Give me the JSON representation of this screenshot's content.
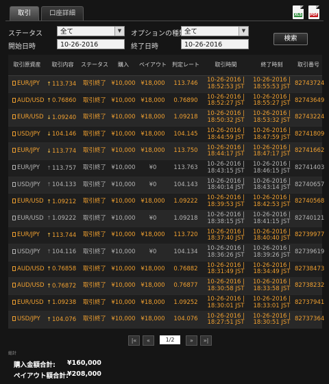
{
  "tabs": [
    {
      "label": "取引"
    },
    {
      "label": "口座詳細"
    }
  ],
  "icons": {
    "export_excel": "excel-file-icon",
    "export_pdf": "pdf-file-icon"
  },
  "filters": {
    "status_label": "ステータス",
    "status_value": "全て",
    "option_type_label": "オプションの種類",
    "option_type_value": "全て",
    "start_label": "開始日時",
    "start_value": "10-26-2016",
    "end_label": "終了日時",
    "end_value": "10-26-2016",
    "search_label": "検索"
  },
  "table": {
    "headers": [
      "取引原資産",
      "取引内容",
      "ステータス",
      "購入",
      "ペイアウト",
      "判定レート",
      "取引時間",
      "終了時刻",
      "取引番号"
    ],
    "rows": [
      {
        "asset": "EUR/JPY",
        "dir": "↑",
        "rate": "113.734",
        "status": "取引終了",
        "buy": "¥10,000",
        "payout": "¥18,000",
        "judge": "113.746",
        "open1": "10-26-2016 |",
        "open2": "18:52:53 JST",
        "close1": "10-26-2016 |",
        "close2": "18:55:53 JST",
        "id": "82743724",
        "result": "win"
      },
      {
        "asset": "AUD/USD",
        "dir": "↑",
        "rate": "0.76860",
        "status": "取引終了",
        "buy": "¥10,000",
        "payout": "¥18,000",
        "judge": "0.76890",
        "open1": "10-26-2016 |",
        "open2": "18:52:27 JST",
        "close1": "10-26-2016 |",
        "close2": "18:55:27 JST",
        "id": "82743649",
        "result": "win"
      },
      {
        "asset": "EUR/USD",
        "dir": "↓",
        "rate": "1.09240",
        "status": "取引終了",
        "buy": "¥10,000",
        "payout": "¥18,000",
        "judge": "1.09218",
        "open1": "10-26-2016 |",
        "open2": "18:50:32 JST",
        "close1": "10-26-2016 |",
        "close2": "18:53:32 JST",
        "id": "82743224",
        "result": "win"
      },
      {
        "asset": "USD/JPY",
        "dir": "↓",
        "rate": "104.146",
        "status": "取引終了",
        "buy": "¥10,000",
        "payout": "¥18,000",
        "judge": "104.145",
        "open1": "10-26-2016 |",
        "open2": "18:44:59 JST",
        "close1": "10-26-2016 |",
        "close2": "18:47:59 JST",
        "id": "82741809",
        "result": "win"
      },
      {
        "asset": "EUR/JPY",
        "dir": "↓",
        "rate": "113.774",
        "status": "取引終了",
        "buy": "¥10,000",
        "payout": "¥18,000",
        "judge": "113.750",
        "open1": "10-26-2016 |",
        "open2": "18:44:17 JST",
        "close1": "10-26-2016 |",
        "close2": "18:47:17 JST",
        "id": "82741662",
        "result": "win"
      },
      {
        "asset": "EUR/JPY",
        "dir": "↑",
        "rate": "113.757",
        "status": "取引終了",
        "buy": "¥10,000",
        "payout": "¥0",
        "judge": "113.763",
        "open1": "10-26-2016 |",
        "open2": "18:43:15 JST",
        "close1": "10-26-2016 |",
        "close2": "18:46:15 JST",
        "id": "82741403",
        "result": "loss"
      },
      {
        "asset": "USD/JPY",
        "dir": "↑",
        "rate": "104.133",
        "status": "取引終了",
        "buy": "¥10,000",
        "payout": "¥0",
        "judge": "104.143",
        "open1": "10-26-2016 |",
        "open2": "18:40:14 JST",
        "close1": "10-26-2016 |",
        "close2": "18:43:14 JST",
        "id": "82740657",
        "result": "loss"
      },
      {
        "asset": "EUR/USD",
        "dir": "↑",
        "rate": "1.09212",
        "status": "取引終了",
        "buy": "¥10,000",
        "payout": "¥18,000",
        "judge": "1.09222",
        "open1": "10-26-2016 |",
        "open2": "18:39:53 JST",
        "close1": "10-26-2016 |",
        "close2": "18:42:53 JST",
        "id": "82740568",
        "result": "win"
      },
      {
        "asset": "EUR/USD",
        "dir": "↑",
        "rate": "1.09222",
        "status": "取引終了",
        "buy": "¥10,000",
        "payout": "¥0",
        "judge": "1.09218",
        "open1": "10-26-2016 |",
        "open2": "18:38:15 JST",
        "close1": "10-26-2016 |",
        "close2": "18:41:15 JST",
        "id": "82740121",
        "result": "loss"
      },
      {
        "asset": "EUR/JPY",
        "dir": "↑",
        "rate": "113.744",
        "status": "取引終了",
        "buy": "¥10,000",
        "payout": "¥18,000",
        "judge": "113.720",
        "open1": "10-26-2016 |",
        "open2": "18:37:40 JST",
        "close1": "10-26-2016 |",
        "close2": "18:40:40 JST",
        "id": "82739977",
        "result": "win"
      },
      {
        "asset": "USD/JPY",
        "dir": "↑",
        "rate": "104.116",
        "status": "取引終了",
        "buy": "¥10,000",
        "payout": "¥0",
        "judge": "104.134",
        "open1": "10-26-2016 |",
        "open2": "18:36:26 JST",
        "close1": "10-26-2016 |",
        "close2": "18:39:26 JST",
        "id": "82739619",
        "result": "loss"
      },
      {
        "asset": "AUD/USD",
        "dir": "↑",
        "rate": "0.76858",
        "status": "取引終了",
        "buy": "¥10,000",
        "payout": "¥18,000",
        "judge": "0.76882",
        "open1": "10-26-2016 |",
        "open2": "18:31:49 JST",
        "close1": "10-26-2016 |",
        "close2": "18:34:49 JST",
        "id": "82738473",
        "result": "win"
      },
      {
        "asset": "AUD/USD",
        "dir": "↑",
        "rate": "0.76872",
        "status": "取引終了",
        "buy": "¥10,000",
        "payout": "¥18,000",
        "judge": "0.76877",
        "open1": "10-26-2016 |",
        "open2": "18:30:58 JST",
        "close1": "10-26-2016 |",
        "close2": "18:33:58 JST",
        "id": "82738232",
        "result": "win"
      },
      {
        "asset": "EUR/USD",
        "dir": "↑",
        "rate": "1.09238",
        "status": "取引終了",
        "buy": "¥10,000",
        "payout": "¥18,000",
        "judge": "1.09252",
        "open1": "10-26-2016 |",
        "open2": "18:30:01 JST",
        "close1": "10-26-2016 |",
        "close2": "18:33:01 JST",
        "id": "82737941",
        "result": "win"
      },
      {
        "asset": "USD/JPY",
        "dir": "↑",
        "rate": "104.076",
        "status": "取引終了",
        "buy": "¥10,000",
        "payout": "¥18,000",
        "judge": "104.076",
        "open1": "10-26-2016 |",
        "open2": "18:27:51 JST",
        "close1": "10-26-2016 |",
        "close2": "18:30:51 JST",
        "id": "82737364",
        "result": "win"
      }
    ]
  },
  "pagination": {
    "first": "|«",
    "prev": "«",
    "page": "1/2",
    "next": "»",
    "last": "»|"
  },
  "summary": {
    "title": "総計",
    "purchase_label": "購入金額合計:",
    "purchase_value": "¥160,000",
    "payout_label": "ペイアウト額合計:",
    "payout_value": "¥208,000"
  },
  "colors": {
    "win": "#f0a030",
    "loss": "#b4b4b4",
    "background": "#151515"
  }
}
